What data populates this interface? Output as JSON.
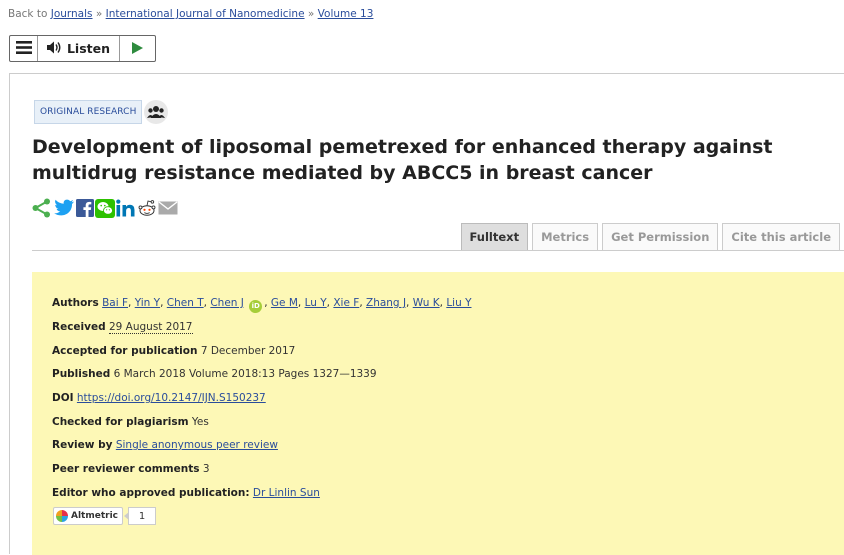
{
  "breadcrumb": {
    "prefix": "Back to",
    "links": [
      "Journals",
      "International Journal of Nanomedicine",
      "Volume 13"
    ],
    "separator": "»"
  },
  "toolbar": {
    "menu_icon": "hamburger-icon",
    "speaker_icon": "speaker-icon",
    "listen_label": "Listen",
    "play_icon": "play-icon"
  },
  "article": {
    "type_label": "ORIGINAL RESEARCH",
    "type_icon": "people-group-icon",
    "title": "Development of liposomal pemetrexed for enhanced therapy against multidrug resistance mediated by ABCC5 in breast cancer",
    "share_icons": [
      "share-icon",
      "twitter-icon",
      "facebook-icon",
      "wechat-icon",
      "linkedin-icon",
      "reddit-icon",
      "email-icon"
    ]
  },
  "tabs": [
    {
      "label": "Fulltext",
      "active": true
    },
    {
      "label": "Metrics",
      "active": false
    },
    {
      "label": "Get Permission",
      "active": false
    },
    {
      "label": "Cite this article",
      "active": false
    }
  ],
  "meta": {
    "authors_label": "Authors",
    "authors_before_orcid": [
      "Bai F",
      "Yin Y",
      "Chen T",
      "Chen J"
    ],
    "authors_after_orcid": [
      "Ge M",
      "Lu Y",
      "Xie F",
      "Zhang J",
      "Wu K",
      "Liu Y"
    ],
    "received_label": "Received",
    "received_value": "29 August 2017",
    "accepted_label": "Accepted for publication",
    "accepted_value": "7 December 2017",
    "published_label": "Published",
    "published_value": "6 March 2018 Volume 2018:13 Pages 1327—1339",
    "doi_label": "DOI",
    "doi_value": "https://doi.org/10.2147/IJN.S150237",
    "plagiarism_label": "Checked for plagiarism",
    "plagiarism_value": "Yes",
    "review_label": "Review by",
    "review_value": "Single anonymous peer review",
    "comments_label": "Peer reviewer comments",
    "comments_value": "3",
    "editor_label": "Editor who approved publication:",
    "editor_value": "Dr Linlin Sun",
    "altmetric_label": "Altmetric",
    "altmetric_count": "1"
  },
  "colors": {
    "meta_background": "#fdf8b6",
    "link": "#2a4d9b",
    "share_green": "#4caf50",
    "twitter": "#1da1f2",
    "facebook": "#3b5998",
    "wechat": "#2dc100",
    "linkedin": "#0077b5",
    "orcid": "#a6ce39"
  }
}
